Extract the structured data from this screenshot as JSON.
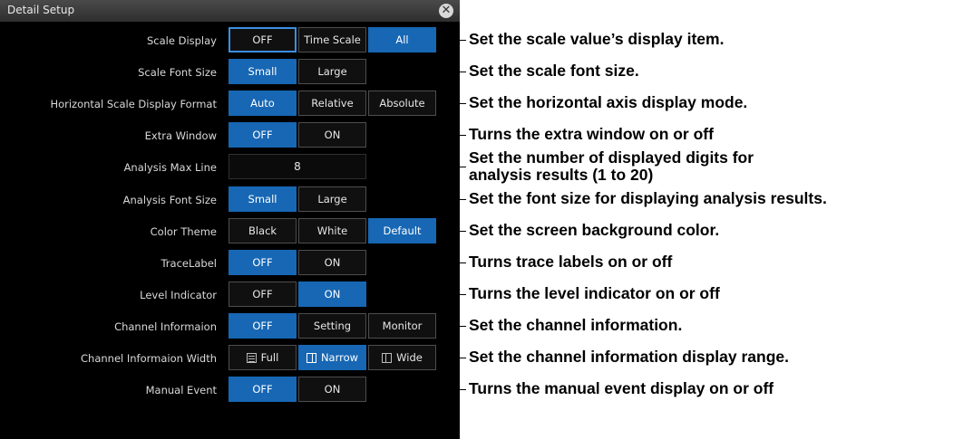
{
  "window": {
    "title": "Detail Setup",
    "close_glyph": "✕"
  },
  "rows": [
    {
      "label": "Scale Display",
      "buttons": [
        "OFF",
        "Time Scale",
        "All"
      ],
      "selected": "All"
    },
    {
      "label": "Scale Font Size",
      "buttons": [
        "Small",
        "Large"
      ],
      "selected": "Small"
    },
    {
      "label": "Horizontal Scale Display Format",
      "buttons": [
        "Auto",
        "Relative",
        "Absolute"
      ],
      "selected": "Auto"
    },
    {
      "label": "Extra Window",
      "buttons": [
        "OFF",
        "ON"
      ],
      "selected": "OFF"
    },
    {
      "label": "Analysis Max Line",
      "value": "8"
    },
    {
      "label": "Analysis Font Size",
      "buttons": [
        "Small",
        "Large"
      ],
      "selected": "Small"
    },
    {
      "label": "Color Theme",
      "buttons": [
        "Black",
        "White",
        "Default"
      ],
      "selected": "Default"
    },
    {
      "label": "TraceLabel",
      "buttons": [
        "OFF",
        "ON"
      ],
      "selected": "OFF"
    },
    {
      "label": "Level Indicator",
      "buttons": [
        "OFF",
        "ON"
      ],
      "selected": "ON"
    },
    {
      "label": "Channel Informaion",
      "buttons": [
        "OFF",
        "Setting",
        "Monitor"
      ],
      "selected": "OFF"
    },
    {
      "label": "Channel Informaion Width",
      "buttons": [
        "Full",
        "Narrow",
        "Wide"
      ],
      "selected": "Narrow",
      "icons": [
        "full-width-icon",
        "narrow-width-icon",
        "wide-width-icon"
      ]
    },
    {
      "label": "Manual Event",
      "buttons": [
        "OFF",
        "ON"
      ],
      "selected": "OFF"
    }
  ],
  "annotations": [
    "Set the scale value’s display item.",
    "Set the scale font size.",
    "Set the horizontal axis display mode.",
    "Turns the extra window on or off",
    "Set the number of displayed digits for\nanalysis results (1 to 20)",
    "Set the font size for displaying analysis results.",
    "Set the screen background color.",
    "Turns trace labels on or off",
    "Turns the level indicator on or off",
    "Set the channel information.",
    "Set the channel information display range.",
    "Turns the manual event display on or off"
  ],
  "colors": {
    "selected": "#1767b4",
    "panel": "#000000",
    "focus_border": "#3c8fe0"
  }
}
